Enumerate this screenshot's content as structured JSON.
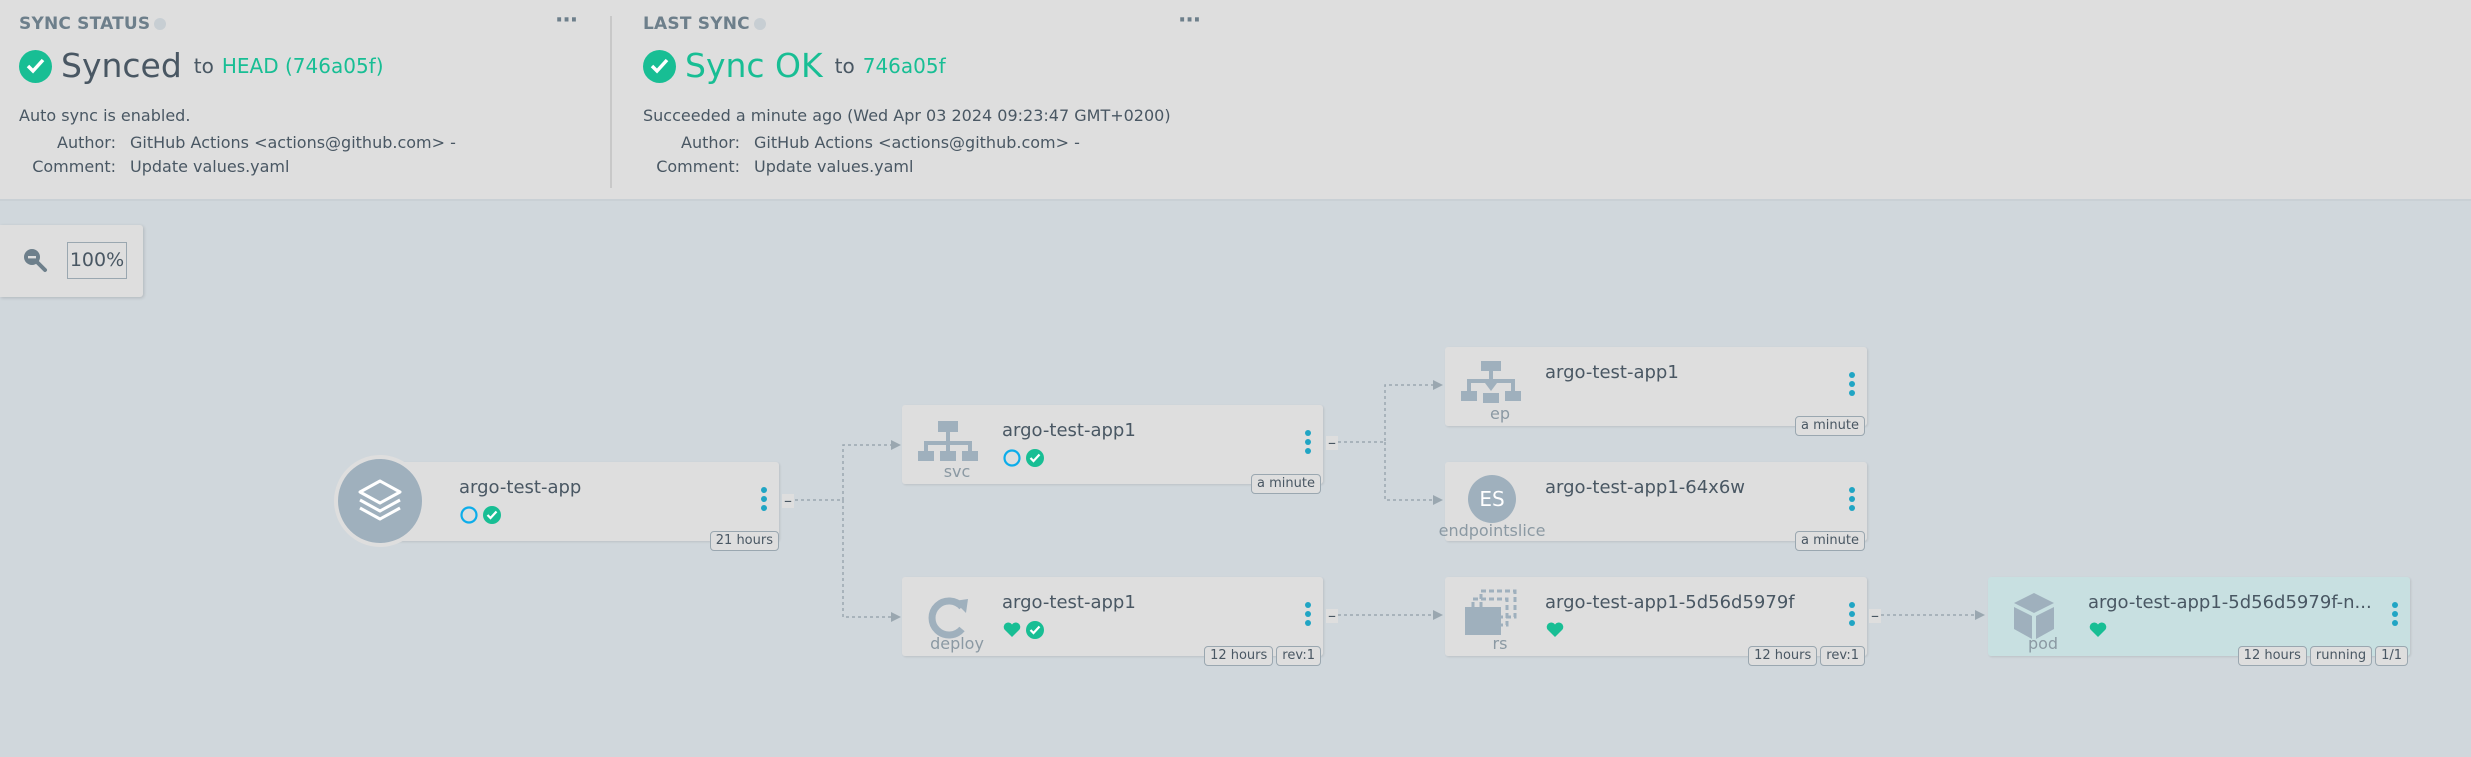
{
  "sync_status": {
    "title": "SYNC STATUS",
    "status": "Synced",
    "to_label": "to",
    "revision": "HEAD (746a05f)",
    "auto_sync": "Auto sync is enabled.",
    "author_label": "Author:",
    "author": "GitHub Actions <actions@github.com> -",
    "comment_label": "Comment:",
    "comment": "Update values.yaml",
    "menu": "···"
  },
  "last_sync": {
    "title": "LAST SYNC",
    "status": "Sync OK",
    "to_label": "to",
    "revision": "746a05f",
    "succeeded": "Succeeded a minute ago (Wed Apr 03 2024 09:23:47 GMT+0200)",
    "author_label": "Author:",
    "author": "GitHub Actions <actions@github.com> -",
    "comment_label": "Comment:",
    "comment": "Update values.yaml",
    "menu": "···"
  },
  "zoom": {
    "value": "100%"
  },
  "nodes": {
    "app": {
      "name": "argo-test-app",
      "tags": [
        "21 hours"
      ]
    },
    "svc": {
      "name": "argo-test-app1",
      "kind": "svc",
      "tags": [
        "a minute"
      ]
    },
    "deploy": {
      "name": "argo-test-app1",
      "kind": "deploy",
      "tags": [
        "12 hours",
        "rev:1"
      ]
    },
    "ep": {
      "name": "argo-test-app1",
      "kind": "ep",
      "tags": [
        "a minute"
      ]
    },
    "endpointslice": {
      "name": "argo-test-app1-64x6w",
      "kind": "endpointslice",
      "icon_text": "ES",
      "tags": [
        "a minute"
      ]
    },
    "rs": {
      "name": "argo-test-app1-5d56d5979f",
      "kind": "rs",
      "tags": [
        "12 hours",
        "rev:1"
      ]
    },
    "pod": {
      "name": "argo-test-app1-5d56d5979f-n...",
      "kind": "pod",
      "tags": [
        "12 hours",
        "running",
        "1/1"
      ]
    }
  },
  "collapse_symbol": "–",
  "colors": {
    "accent_green": "#18be94",
    "accent_blue": "#20a5c4",
    "icon_gray": "#9fb0bd",
    "progress_blue": "#0dadea"
  }
}
